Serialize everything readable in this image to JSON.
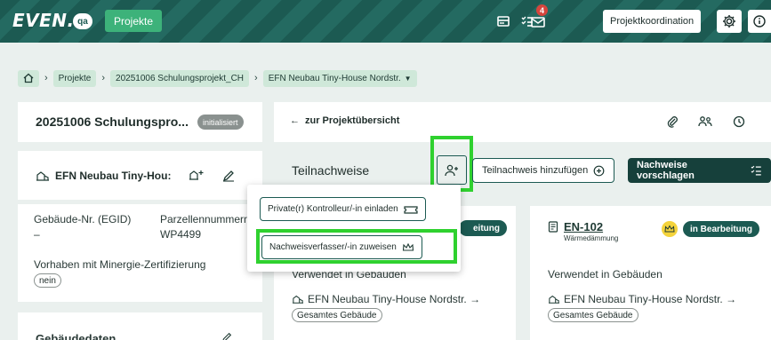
{
  "header": {
    "logo": "EVEN.",
    "env": "qa",
    "projects_button": "Projekte",
    "notification_count": "4",
    "role_button": "Projektkoordination"
  },
  "breadcrumb": {
    "items": [
      "Projekte",
      "20251006 Schulungsprojekt_CH",
      "EFN Neubau Tiny-House Nordstr."
    ]
  },
  "left": {
    "project_title": "20251006 Schulungspro...",
    "project_status": "initialisiert",
    "building_title": "EFN Neubau Tiny-Hou:",
    "egid_label": "Gebäude-Nr. (EGID)",
    "egid_value": "–",
    "parcel_label": "Parzellennummern",
    "parcel_value": "WP4499",
    "minergie_label": "Vorhaben mit Minergie-Zertifizierung",
    "minergie_value": "nein",
    "next_section": "Gebäudedaten"
  },
  "main": {
    "back_link": "zur Projektübersicht",
    "section_title": "Teilnachweise",
    "add_button": "Teilnachweis hinzufügen",
    "suggest_button": "Nachweise vorschlagen"
  },
  "popup": {
    "invite_label": "Private(r) Kontrolleur/-in einladen",
    "assign_label": "Nachweisverfasser/-in zuweisen"
  },
  "cards": [
    {
      "code": "",
      "subtitle": "",
      "status": "eitung",
      "used_label": "Verwendet in Gebäuden",
      "building": "EFN Neubau Tiny-House Nordstr. →",
      "scope": "Gesamtes Gebäude"
    },
    {
      "code": "EN-102",
      "subtitle": "Wärmedämmung",
      "status": "in Bearbeitung",
      "used_label": "Verwendet in Gebäuden",
      "building": "EFN Neubau Tiny-House Nordstr. →",
      "scope": "Gesamtes Gebäude"
    }
  ],
  "colors": {
    "brand": "#1c5a52",
    "accent_green": "#3db27a",
    "highlight": "#2fd12f",
    "crown": "#f4d33c",
    "alert": "#d6453d"
  }
}
